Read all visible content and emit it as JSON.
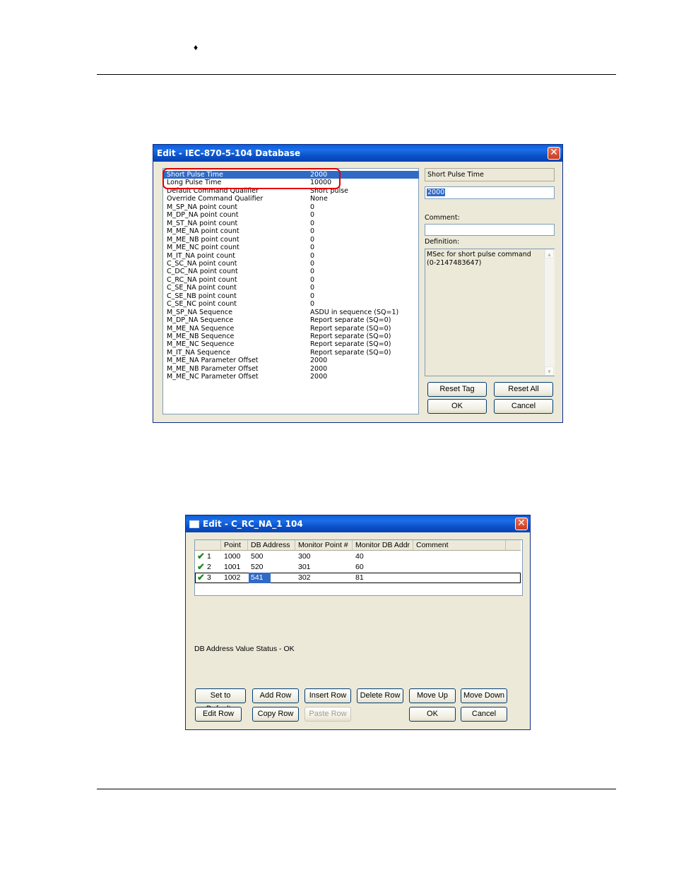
{
  "page": {
    "bullet": "♦"
  },
  "dialog1": {
    "title": "Edit - IEC-870-5-104 Database",
    "rows": [
      {
        "name": "Short Pulse Time",
        "value": "2000"
      },
      {
        "name": "Long Pulse Time",
        "value": "10000"
      },
      {
        "name": "Default Command Qualifier",
        "value": "Short pulse"
      },
      {
        "name": "Override Command Qualifier",
        "value": "None"
      },
      {
        "name": "M_SP_NA point count",
        "value": "0"
      },
      {
        "name": "M_DP_NA point count",
        "value": "0"
      },
      {
        "name": "M_ST_NA point count",
        "value": "0"
      },
      {
        "name": "M_ME_NA point count",
        "value": "0"
      },
      {
        "name": "M_ME_NB point count",
        "value": "0"
      },
      {
        "name": "M_ME_NC point count",
        "value": "0"
      },
      {
        "name": "M_IT_NA point count",
        "value": "0"
      },
      {
        "name": "C_SC_NA point count",
        "value": "0"
      },
      {
        "name": "C_DC_NA point count",
        "value": "0"
      },
      {
        "name": "C_RC_NA point count",
        "value": "0"
      },
      {
        "name": "C_SE_NA point count",
        "value": "0"
      },
      {
        "name": "C_SE_NB point count",
        "value": "0"
      },
      {
        "name": "C_SE_NC point count",
        "value": "0"
      },
      {
        "name": "M_SP_NA Sequence",
        "value": "ASDU in sequence (SQ=1)"
      },
      {
        "name": "M_DP_NA Sequence",
        "value": "Report separate (SQ=0)"
      },
      {
        "name": "M_ME_NA Sequence",
        "value": "Report separate (SQ=0)"
      },
      {
        "name": "M_ME_NB Sequence",
        "value": "Report separate (SQ=0)"
      },
      {
        "name": "M_ME_NC Sequence",
        "value": "Report separate (SQ=0)"
      },
      {
        "name": "M_IT_NA Sequence",
        "value": "Report separate (SQ=0)"
      },
      {
        "name": "M_ME_NA Parameter Offset",
        "value": "2000"
      },
      {
        "name": "M_ME_NB Parameter Offset",
        "value": "2000"
      },
      {
        "name": "M_ME_NC Parameter Offset",
        "value": "2000"
      }
    ],
    "selected_name": "Short Pulse Time",
    "value_field": "2000",
    "comment_label": "Comment:",
    "comment_value": "",
    "definition_label": "Definition:",
    "definition_text": "MSec for short pulse command\n(0-2147483647)",
    "buttons": {
      "reset_tag": "Reset Tag",
      "reset_all": "Reset All",
      "ok": "OK",
      "cancel": "Cancel"
    }
  },
  "dialog2": {
    "title": "Edit - C_RC_NA_1 104",
    "columns": [
      "",
      "Point",
      "DB Address",
      "Monitor Point #",
      "Monitor DB Addr",
      "Comment"
    ],
    "rows": [
      {
        "index": "1",
        "point": "1000",
        "db_address": "500",
        "monitor_point": "300",
        "monitor_db_addr": "40",
        "comment": ""
      },
      {
        "index": "2",
        "point": "1001",
        "db_address": "520",
        "monitor_point": "301",
        "monitor_db_addr": "60",
        "comment": ""
      },
      {
        "index": "3",
        "point": "1002",
        "db_address": "541",
        "monitor_point": "302",
        "monitor_db_addr": "81",
        "comment": ""
      }
    ],
    "status_text": "DB Address Value Status - OK",
    "buttons": {
      "set_to_defaults": "Set to Defaults",
      "add_row": "Add Row",
      "insert_row": "Insert Row",
      "delete_row": "Delete Row",
      "move_up": "Move Up",
      "move_down": "Move Down",
      "edit_row": "Edit Row",
      "copy_row": "Copy Row",
      "paste_row": "Paste Row",
      "ok": "OK",
      "cancel": "Cancel"
    }
  },
  "colors": {
    "selection": "#316ac5",
    "highlight_box": "#e00000",
    "check": "#1d8a1d",
    "dialog_bg": "#ece9d8",
    "title_bar": "#0a5fd8"
  }
}
